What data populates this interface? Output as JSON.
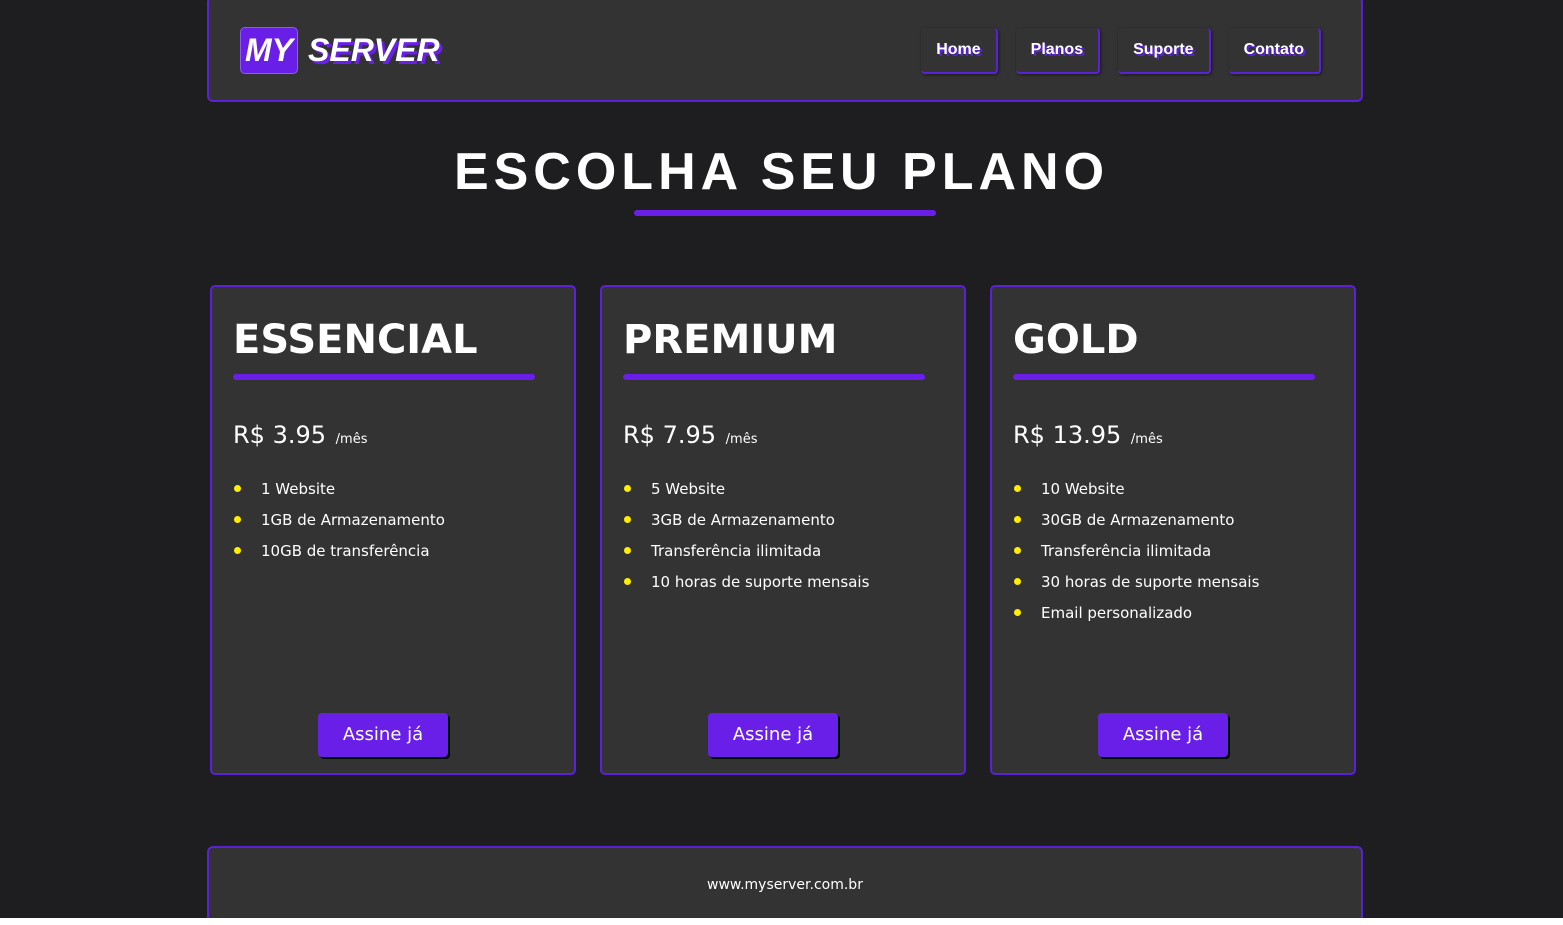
{
  "header": {
    "logo_box": "MY",
    "logo_text": "SERVER",
    "nav": [
      {
        "label": "Home"
      },
      {
        "label": "Planos"
      },
      {
        "label": "Suporte"
      },
      {
        "label": "Contato"
      }
    ]
  },
  "main": {
    "title": "ESCOLHA SEU PLANO",
    "plans": [
      {
        "name": "ESSENCIAL",
        "price": "R$ 3.95",
        "period": "/mês",
        "features": [
          "1 Website",
          "1GB de Armazenamento",
          "10GB de transferência"
        ],
        "cta": "Assine já"
      },
      {
        "name": "PREMIUM",
        "price": "R$ 7.95",
        "period": "/mês",
        "features": [
          "5 Website",
          "3GB de Armazenamento",
          "Transferência ilimitada",
          "10 horas de suporte mensais"
        ],
        "cta": "Assine já"
      },
      {
        "name": "GOLD",
        "price": "R$ 13.95",
        "period": "/mês",
        "features": [
          "10 Website",
          "30GB de Armazenamento",
          "Transferência ilimitada",
          "30 horas de suporte mensais",
          "Email personalizado"
        ],
        "cta": "Assine já"
      }
    ]
  },
  "footer": {
    "text": "www.myserver.com.br"
  },
  "colors": {
    "background": "#1e1d20",
    "panel": "#333333",
    "accent": "#6a1fe8",
    "border": "#5b21d6",
    "bullet": "#ffee00"
  }
}
